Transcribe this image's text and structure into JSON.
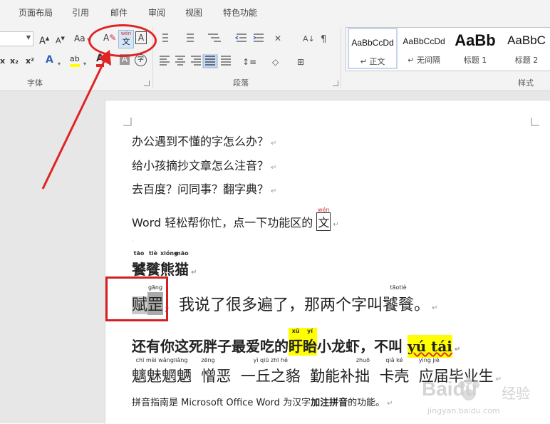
{
  "tabs": [
    "页面布局",
    "引用",
    "邮件",
    "审阅",
    "视图",
    "特色功能"
  ],
  "groups": {
    "font": "字体",
    "paragraph": "段落",
    "styles": "样式"
  },
  "font_buttons": {
    "grow": "A",
    "shrink": "A",
    "case": "Aa",
    "clear": "A",
    "phonetic_top": "wén",
    "phonetic_bottom": "文",
    "border_char": "A",
    "sub": "x₂",
    "sup": "x²",
    "effects": "A",
    "highlight": "ab",
    "color": "A",
    "shade": "A",
    "enclose": "字"
  },
  "styles": [
    {
      "sample": "AaBbCcDd",
      "name": "↵ 正文",
      "size": 12,
      "bold": false
    },
    {
      "sample": "AaBbCcDd",
      "name": "↵ 无间隔",
      "size": 12,
      "bold": false
    },
    {
      "sample": "AaBb",
      "name": "标题 1",
      "size": 22,
      "bold": true
    },
    {
      "sample": "AaBbC",
      "name": "标题 2",
      "size": 17,
      "bold": false
    }
  ],
  "document": {
    "line1": "办公遇到不懂的字怎么办？",
    "line2": "给小孩摘抄文章怎么注音？",
    "line3": "去百度？问同事？翻字典？",
    "line4_text": "Word  轻松帮你忙，点一下功能区的",
    "line4_icon_pinyin": "wén",
    "line4_icon_char": "文",
    "heading": {
      "chars": [
        "饕",
        "餮",
        "熊",
        "猫"
      ],
      "pinyin": [
        "tāo",
        "tiè",
        "xióng",
        "māo"
      ]
    },
    "sentence1": {
      "c1": "赋",
      "c2": "罡",
      "c2_pinyin": "gāng",
      "middle": "，我说了很多遍了，那两个字叫",
      "tail_chars": "饕餮",
      "tail_pinyin": "tāotiè",
      "end": "。"
    },
    "sentence2": {
      "start": "还有你这死胖子最爱吃的",
      "hl1": [
        "盱",
        "眙"
      ],
      "hl1_pinyin": [
        "xū",
        "yí"
      ],
      "middle": "小龙虾，不叫 ",
      "hl2": "yú  tái"
    },
    "sentence3": {
      "groups": [
        {
          "chars": "魑魅魍魉",
          "pinyin": "chī mèi wǎngliǎng"
        },
        {
          "chars": "憎恶",
          "pinyin": "zēng"
        },
        {
          "chars": "一丘之貉",
          "pinyin": "yì  qiū zhī  hé"
        },
        {
          "chars": "勤能补拙",
          "pinyin": "zhuō"
        },
        {
          "chars": "卡壳",
          "pinyin": "qiǎ  ké"
        },
        {
          "chars": "应届毕业生",
          "pinyin": "yìng jiè"
        }
      ]
    },
    "footer": {
      "a": "拼音指南是 Microsoft Office Word 为汉字",
      "b": "加注拼音",
      "c": "的功能。"
    }
  },
  "watermark": {
    "brand": "Baidu",
    "sub": "经验",
    "url": "jingyan.baidu.com"
  },
  "colors": {
    "annotation_red": "#e02424",
    "highlight": "#ffff00",
    "ribbon_bg": "#f3f3f3"
  }
}
